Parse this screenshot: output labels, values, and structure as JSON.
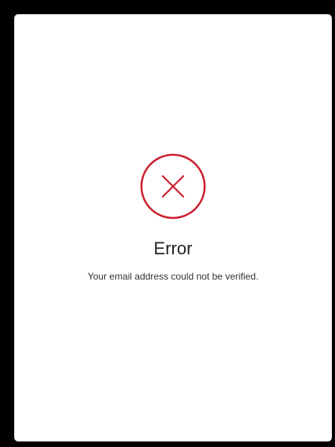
{
  "dialog": {
    "icon": "close-circle-icon",
    "title": "Error",
    "message": "Your email address could not be verified."
  },
  "colors": {
    "background": "#000000",
    "dialog": "#ffffff",
    "error_accent": "#cc1f2f",
    "text": "#222222"
  }
}
